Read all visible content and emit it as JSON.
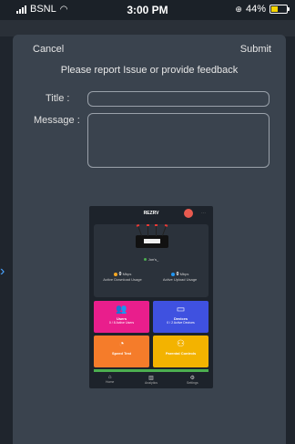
{
  "status_bar": {
    "carrier": "BSNL",
    "time": "3:00 PM",
    "battery": "44%",
    "battery_color": "#f5d400"
  },
  "sheet": {
    "cancel_label": "Cancel",
    "submit_label": "Submit",
    "prompt": "Please report Issue or provide feedback",
    "title_label": "Title :",
    "title_value": "",
    "message_label": "Message :",
    "message_value": ""
  },
  "attachment": {
    "app_name": "REZRV",
    "device_status": "Jon's_",
    "download": {
      "value": "0",
      "unit": "Mbps",
      "label": "Active Download Usage"
    },
    "upload": {
      "value": "0",
      "unit": "Mbps",
      "label": "Active Upload Usage"
    },
    "tiles": [
      {
        "title": "Users",
        "sub": "0 / 8 Active Users",
        "icon": "users-icon",
        "color": "#e91e8c"
      },
      {
        "title": "Devices",
        "sub": "0 / 2 Active Devices",
        "icon": "devices-icon",
        "color": "#3f51e0"
      },
      {
        "title": "Speed Test",
        "sub": "",
        "icon": "speedometer-icon",
        "color": "#f57c2a"
      },
      {
        "title": "Parental Controls",
        "sub": "",
        "icon": "parental-icon",
        "color": "#f3b300"
      }
    ],
    "nav": [
      "Home",
      "Analytics",
      "Settings"
    ]
  },
  "accent_color": "#4aa3ff"
}
